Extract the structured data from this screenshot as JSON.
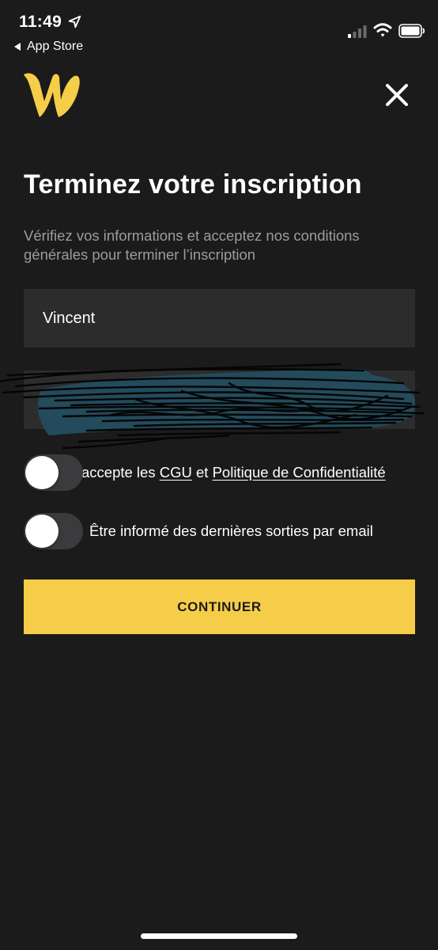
{
  "status_bar": {
    "time": "11:49",
    "back_label": "App Store",
    "icons": [
      "location-arrow-icon",
      "cellular-signal-icon",
      "wifi-icon",
      "battery-icon"
    ]
  },
  "header": {
    "logo_icon": "w-logo-icon",
    "close_icon": "close-icon"
  },
  "content": {
    "title": "Terminez votre inscription",
    "subtitle": "Vérifiez vos informations et acceptez nos conditions générales pour terminer l’inscription"
  },
  "form": {
    "first_name_value": "Vincent",
    "second_field_value": ""
  },
  "toggles": {
    "terms": {
      "prefix": "accepte les",
      "cgu_link": "CGU",
      "connector": "et",
      "privacy_link": "Politique de Confidentialité",
      "checked": false
    },
    "newsletter": {
      "label": "Être informé des dernières sorties par email",
      "checked": false
    }
  },
  "actions": {
    "continue_label": "CONTINUER"
  },
  "colors": {
    "background": "#1b1b1b",
    "field_background": "#2c2c2c",
    "accent": "#f6cd48",
    "muted_text": "#9c9c9c",
    "toggle_off": "#3b3b3d",
    "redaction_fill": "#234b5c"
  }
}
